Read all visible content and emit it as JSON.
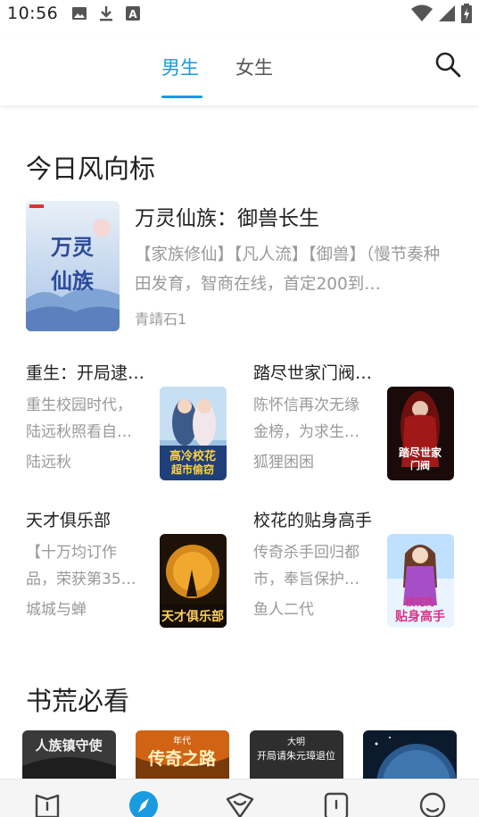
{
  "status_bar": {
    "time": "10:56",
    "left_icons": [
      "image-icon",
      "download-icon",
      "text-a-icon"
    ],
    "right_icons": [
      "wifi-icon",
      "signal-icon",
      "battery-icon"
    ]
  },
  "tabs": [
    {
      "label": "男生",
      "active": true
    },
    {
      "label": "女生",
      "active": false
    }
  ],
  "accent_color": "#1a9bdf",
  "sections": {
    "trending": {
      "title": "今日风向标",
      "featured": {
        "title": "万灵仙族：御兽长生",
        "description": "【家族修仙】【凡人流】【御兽】（慢节奏种田发育，智商在线，首定200到…",
        "author": "青靖石1",
        "cover_text": "万灵仙族"
      },
      "grid": [
        {
          "title": "重生：开局逮…",
          "description": "重生校园时代，陆远秋照看自…",
          "author": "陆远秋",
          "cover_text": "高冷校花超市偷窃"
        },
        {
          "title": "踏尽世家门阀…",
          "description": "陈怀信再次无缘金榜，为求生…",
          "author": "狐狸困困",
          "cover_text": "踏尽世家门阀"
        },
        {
          "title": "天才俱乐部",
          "description": "【十万均订作品，荣获第35…",
          "author": "城城与蝉",
          "cover_text": "天才俱乐部"
        },
        {
          "title": "校花的贴身高手",
          "description": "传奇杀手回归都市，奉旨保护…",
          "author": "鱼人二代",
          "cover_text": "校花的贴身高手"
        }
      ]
    },
    "must_read": {
      "title": "书荒必看",
      "covers": [
        {
          "cover_text": "人族镇守使"
        },
        {
          "cover_text": "年代 传奇之路"
        },
        {
          "cover_text": "大明 开局请朱元璋退位"
        },
        {
          "cover_text": ""
        }
      ]
    }
  },
  "bottom_nav": [
    {
      "icon": "bookshelf-icon",
      "active": false
    },
    {
      "icon": "discover-compass-icon",
      "active": true
    },
    {
      "icon": "gift-icon",
      "active": false
    },
    {
      "icon": "category-icon",
      "active": false
    },
    {
      "icon": "profile-smile-icon",
      "active": false
    }
  ]
}
